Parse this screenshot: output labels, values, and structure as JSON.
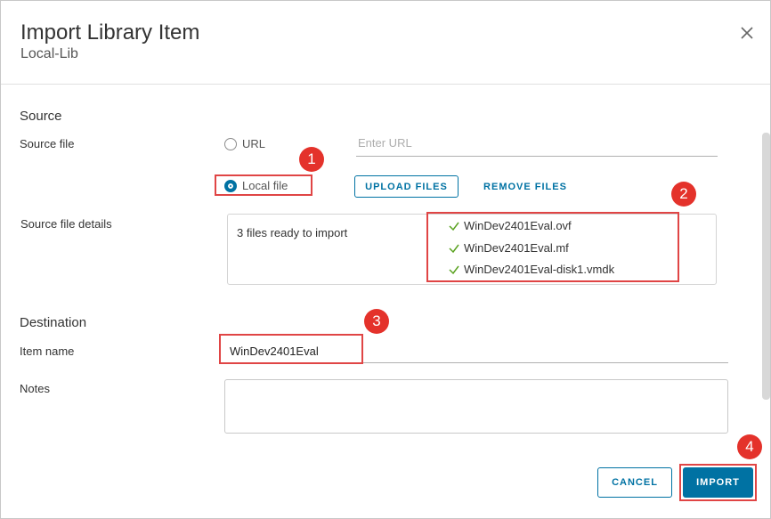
{
  "header": {
    "title": "Import Library Item",
    "subtitle": "Local-Lib"
  },
  "source": {
    "section_title": "Source",
    "source_file_label": "Source file",
    "url_option": "URL",
    "url_placeholder": "Enter URL",
    "local_file_option": "Local file",
    "upload_button": "UPLOAD FILES",
    "remove_button": "REMOVE FILES",
    "details_label": "Source file details",
    "ready_text": "3 files ready to import",
    "files": [
      "WinDev2401Eval.ovf",
      "WinDev2401Eval.mf",
      "WinDev2401Eval-disk1.vmdk"
    ]
  },
  "destination": {
    "section_title": "Destination",
    "item_name_label": "Item name",
    "item_name_value": "WinDev2401Eval",
    "notes_label": "Notes"
  },
  "footer": {
    "cancel_label": "CANCEL",
    "import_label": "IMPORT"
  },
  "callouts": [
    "1",
    "2",
    "3",
    "4"
  ],
  "colors": {
    "accent": "#0072a3",
    "callout": "#e4322b",
    "check": "#5aa220"
  }
}
